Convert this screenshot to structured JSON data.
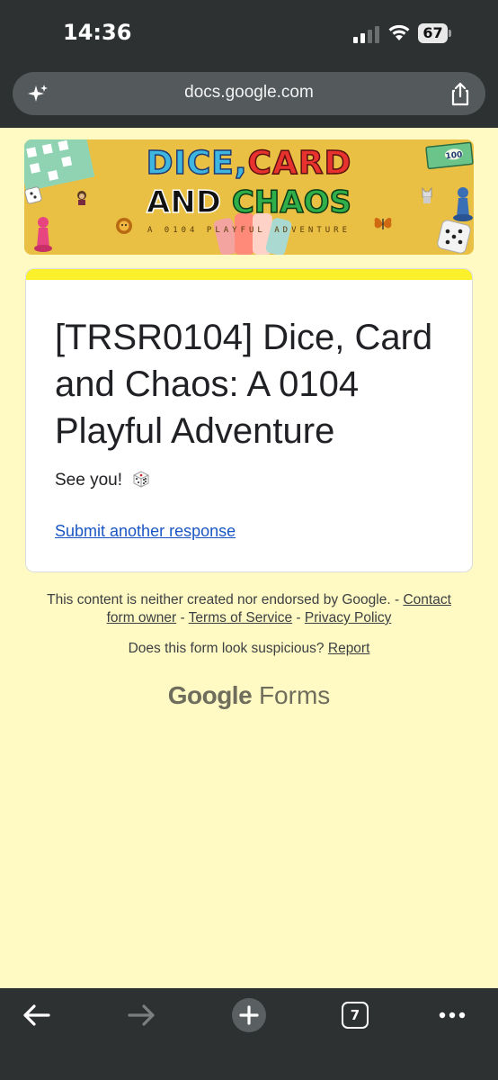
{
  "status_bar": {
    "time": "14:36",
    "battery": "67"
  },
  "browser": {
    "url": "docs.google.com",
    "tab_count": "7"
  },
  "banner": {
    "line1_a": "DICE,",
    "line1_b": "CARD",
    "line2_a": "AND",
    "line2_b": "CHAOS",
    "subtitle": "A 0104 PLAYFUL ADVENTURE",
    "bill_value": "100"
  },
  "form": {
    "title": "[TRSR0104] Dice, Card and Chaos: A 0104 Playful Adventure",
    "confirmation": "See you!",
    "submit_another": "Submit another response"
  },
  "footer": {
    "disclaimer": "This content is neither created nor endorsed by Google. -",
    "contact_owner": "Contact form owner",
    "sep1": "-",
    "terms": "Terms of Service",
    "sep2": "-",
    "privacy": "Privacy Policy",
    "suspicious": "Does this form look suspicious?",
    "report": "Report",
    "brand_google": "Google",
    "brand_forms": "Forms"
  },
  "colors": {
    "page_bg": "#fffac3",
    "accent_strip": "#fcf02a",
    "link": "#1a56c4",
    "browser_chrome": "#2d3132"
  }
}
